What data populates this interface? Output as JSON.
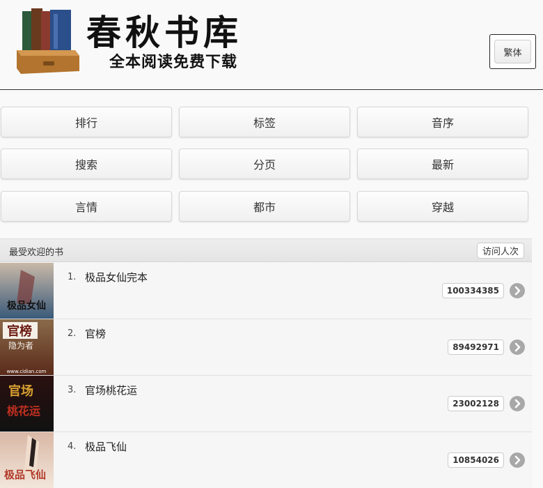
{
  "header": {
    "title": "春秋书库",
    "subtitle": "全本阅读免费下载",
    "traditional_button": "繁体",
    "logo_icon": "bookshelf-icon"
  },
  "nav": {
    "items": [
      {
        "label": "排行"
      },
      {
        "label": "标签"
      },
      {
        "label": "音序"
      },
      {
        "label": "搜索"
      },
      {
        "label": "分页"
      },
      {
        "label": "最新"
      },
      {
        "label": "言情"
      },
      {
        "label": "都市"
      },
      {
        "label": "穿越"
      }
    ]
  },
  "list": {
    "title": "最受欢迎的书",
    "visits_label": "访问人次",
    "books": [
      {
        "rank": "1.",
        "title": "极品女仙完本",
        "count": "100334385",
        "cover_text": "极品女仙",
        "cover_colors": [
          "#3a5a7a",
          "#c9b9a8",
          "#7b3a3a"
        ]
      },
      {
        "rank": "2.",
        "title": "官榜",
        "count": "89492971",
        "cover_text": "官榜",
        "cover_sub": "隐为者",
        "cover_footer": "www.cidian.com",
        "cover_colors": [
          "#5a2a1a",
          "#8a6a4a",
          "#2a1a10"
        ]
      },
      {
        "rank": "3.",
        "title": "官场桃花运",
        "count": "23002128",
        "cover_text": "官场",
        "cover_text2": "桃花运",
        "cover_colors": [
          "#111111",
          "#2a1010",
          "#c8a030"
        ]
      },
      {
        "rank": "4.",
        "title": "极品飞仙",
        "count": "10854026",
        "cover_text": "极品飞仙",
        "cover_colors": [
          "#f2e6da",
          "#d9b7a5",
          "#b23a2a"
        ]
      }
    ],
    "chevron_icon": "chevron-right-icon"
  }
}
